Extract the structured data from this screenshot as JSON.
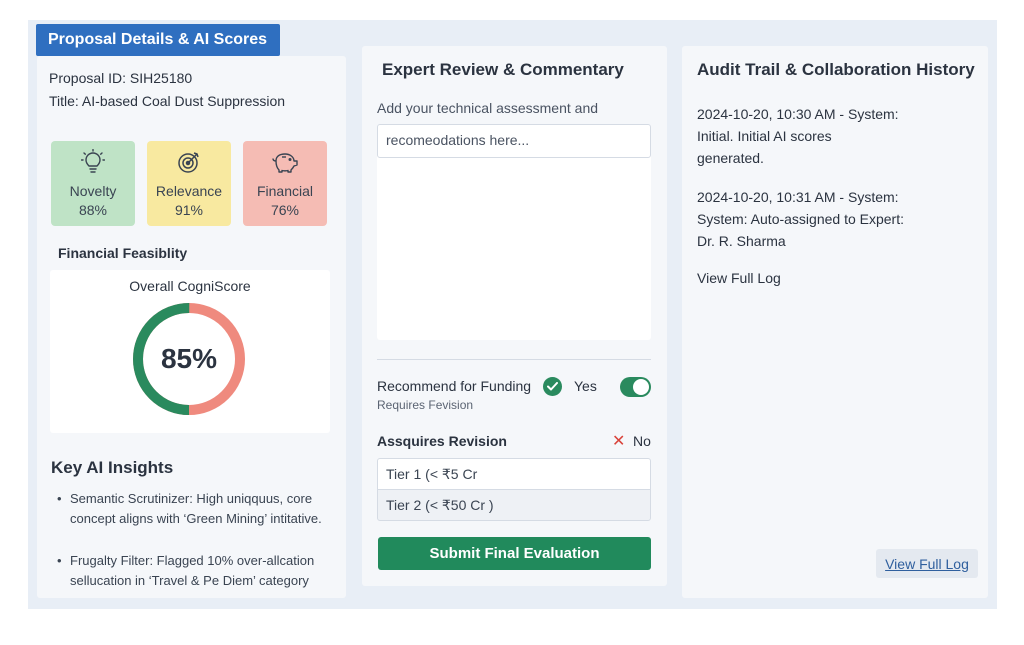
{
  "header": {
    "title": "Proposal Details & AI Scores"
  },
  "proposal": {
    "id": "Proposal ID: SIH25180",
    "title": "Title: AI-based Coal Dust Suppression"
  },
  "scores": [
    {
      "label": "Novelty",
      "value": "88%",
      "icon": "lightbulb-icon",
      "color": "#bfe3c6"
    },
    {
      "label": "Relevance",
      "value": "91%",
      "icon": "target-icon",
      "color": "#f8e9a0"
    },
    {
      "label": "Financial",
      "value": "76%",
      "icon": "piggy-bank-icon",
      "color": "#f5bcb4"
    }
  ],
  "financial_feasibility": "Financial Feasiblity",
  "cogniscore": {
    "title": "Overall CogniScore",
    "value": "85%",
    "fraction": 0.5,
    "colors": {
      "primary": "#2a8a5e",
      "secondary": "#ef8a7e"
    }
  },
  "insights": {
    "heading": "Key AI Insights",
    "items": [
      "Semantic Scrutinizer: High uniqquus, core concept aligns with ‘Green Mining’ intitative.",
      "Frugalty Filter: Flagged 10% over-allcation sellucation in ‘Travel & Pe Diem’ category"
    ]
  },
  "review": {
    "heading": "Expert Review & Commentary",
    "prompt": "Add your technical assessment and",
    "placeholder": "recomeodations here...",
    "recommend_label": "Recommend for Funding",
    "recommend_value": "Yes",
    "recommend_sub": "Requires Fevision",
    "revision_label": "Assquires Revision",
    "revision_value": "No",
    "tiers": [
      "Tier 1 (< ₹5 Cr",
      "Tier 2 (< ₹50 Cr )"
    ],
    "submit_label": "Submit Final Evaluation"
  },
  "audit": {
    "heading": "Audit Trail & Collaboration History",
    "entries": [
      {
        "line1": "2024-10-20, 10:30 AM - System:",
        "line2": "Initial. Initial AI scores",
        "line3": "generated."
      },
      {
        "line1": "2024-10-20, 10:31 AM - System:",
        "line2": "System: Auto-assigned to Expert:",
        "line3": "Dr. R. Sharma"
      }
    ],
    "view_log": "View Full Log",
    "view_log_button": "View Full Log"
  },
  "colors": {
    "accent": "#2f6fc0",
    "success": "#218a5c",
    "danger": "#d9433a"
  }
}
